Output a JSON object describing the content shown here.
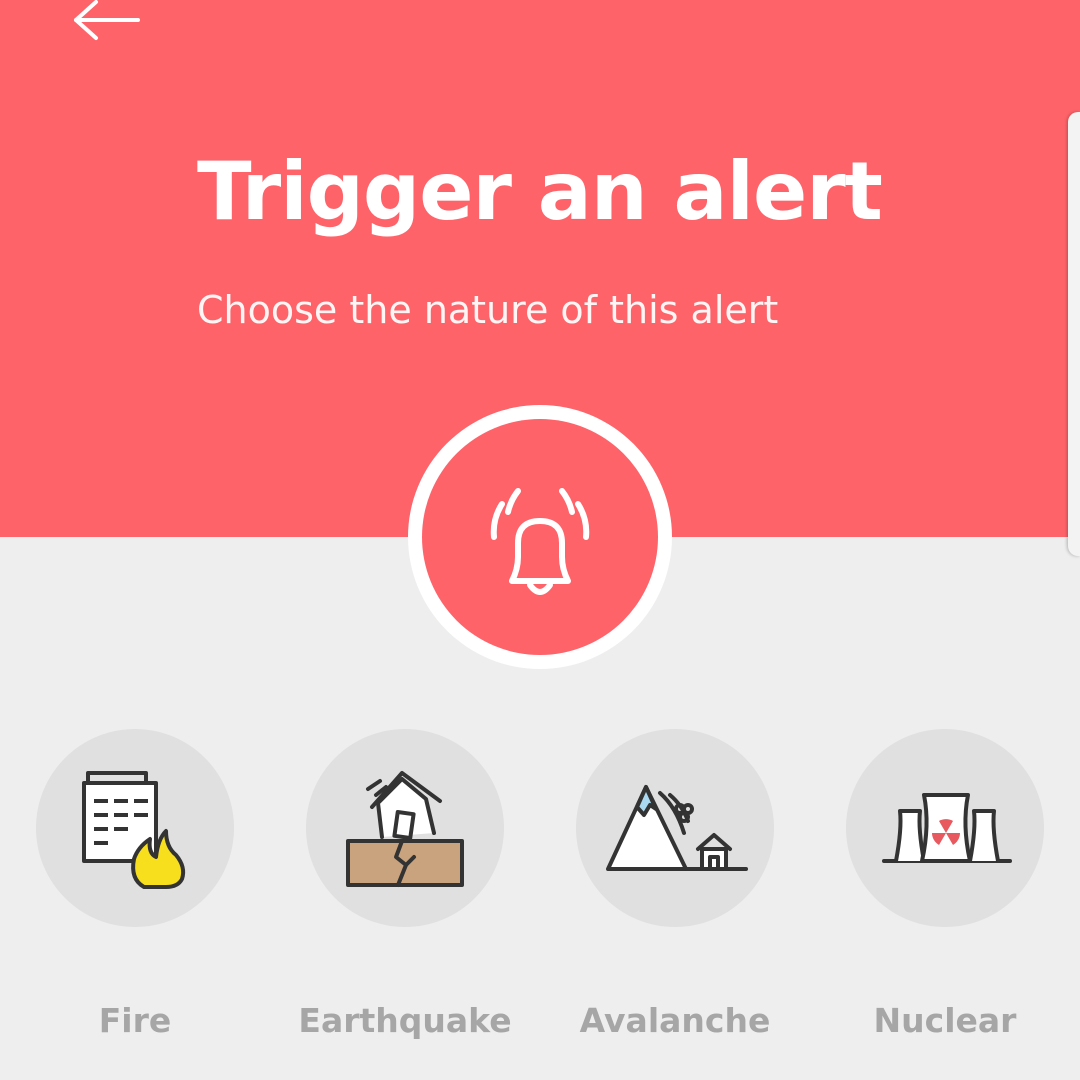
{
  "header": {
    "title": "Trigger an alert",
    "subtitle": "Choose the nature of this alert",
    "background_color": "#ff636a",
    "back_icon": "arrow-left-icon"
  },
  "alert_button": {
    "icon": "ringing-bell-icon",
    "color": "#ff636a"
  },
  "categories": [
    {
      "label": "Fire",
      "icon": "building-fire-icon"
    },
    {
      "label": "Earthquake",
      "icon": "earthquake-house-icon"
    },
    {
      "label": "Avalanche",
      "icon": "avalanche-mountain-icon"
    },
    {
      "label": "Nuclear",
      "icon": "nuclear-plant-icon"
    }
  ],
  "colors": {
    "background": "#eeeeee",
    "category_circle": "#e0e0e0",
    "category_label": "#a6a6a6",
    "icon_stroke": "#333333",
    "fire_yellow": "#f7df1e",
    "earth_brown": "#c9a37d",
    "snow_blue": "#a9d8f0",
    "radiation_red": "#e8585f"
  }
}
